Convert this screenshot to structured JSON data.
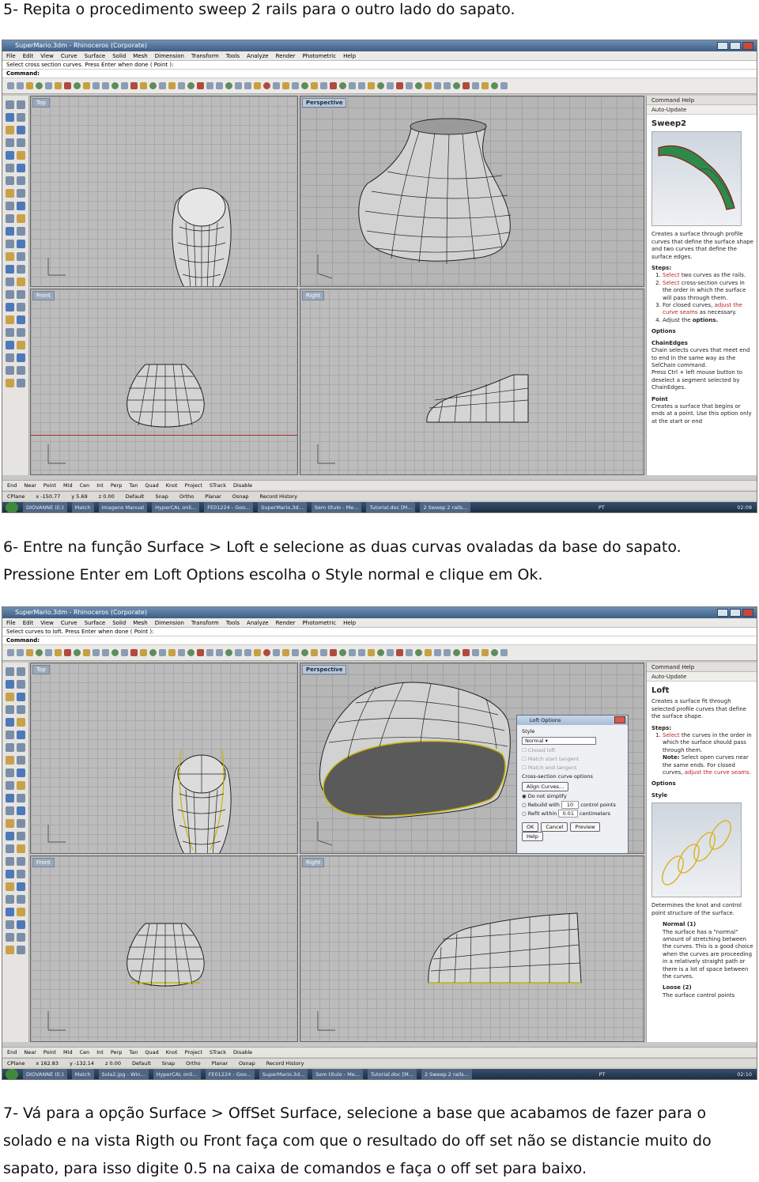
{
  "steps": {
    "step5": "5- Repita o procedimento sweep 2 rails para o outro lado do sapato.",
    "step6_line1": "6- Entre na função Surface > Loft e selecione as duas curvas ovaladas da base do sapato.",
    "step6_line2": "Pressione Enter em Loft Options escolha o Style normal e clique em Ok.",
    "step7_line1": "7- Vá para a opção Surface > OffSet Surface, selecione a base que acabamos de fazer para o",
    "step7_line2": "solado e na vista Rigth ou Front faça com que o resultado do off set não se distancie muito do",
    "step7_line3": "sapato, para isso digite 0.5 na caixa de comandos e faça o off set para baixo."
  },
  "app": {
    "window_title": "SuperMario.3dm - Rhinoceros (Corporate)",
    "menu": [
      "File",
      "Edit",
      "View",
      "Curve",
      "Surface",
      "Solid",
      "Mesh",
      "Dimension",
      "Transform",
      "Tools",
      "Analyze",
      "Render",
      "Photometric",
      "Help"
    ],
    "viewports": {
      "top": "Top",
      "perspective": "Perspective",
      "front": "Front",
      "right": "Right"
    },
    "panel_header": "Command Help",
    "auto_update": "Auto-Update",
    "osnaps": [
      "End",
      "Near",
      "Point",
      "Mid",
      "Cen",
      "Int",
      "Perp",
      "Tan",
      "Quad",
      "Knot",
      "Project",
      "STrack",
      "Disable"
    ],
    "status": {
      "cplane": "CPlane",
      "snap": "Snap",
      "ortho": "Ortho",
      "planar": "Planar",
      "osnap": "Osnap",
      "record": "Record History",
      "layer": "Default"
    }
  },
  "shot1": {
    "prompt": "Select cross section curves. Press Enter when done ( Point ):",
    "command_label": "Command:",
    "coords": {
      "x": "x -150.77",
      "y": "y 5.69",
      "z": "z 0.00"
    },
    "help": {
      "command": "Sweep2",
      "intro": "Creates a surface through profile curves that define the surface shape and two curves that define the surface edges.",
      "steps_title": "Steps:",
      "step1_a": "Select",
      "step1_b": "two curves as the rails.",
      "step2_a": "Select",
      "step2_b": "cross-section curves in the order in which the surface will pass through them.",
      "step3_a": "For closed curves,",
      "step3_b": "adjust the curve seams",
      "step3_c": "as necessary.",
      "step4_a": "Adjust the",
      "step4_b": "options.",
      "options_title": "Options",
      "chainedges_title": "ChainEdges",
      "chainedges_text": "Chain selects curves that meet end to end in the same way as the SelChain command.",
      "chainedges_text2": "Press Ctrl + left mouse button to deselect a segment selected by ChainEdges.",
      "point_title": "Point",
      "point_text": "Creates a surface that begins or ends at a point. Use this option only at the start or end"
    },
    "taskbar": [
      "DIOVANNE (E:)",
      "Match",
      "Imagens Manual",
      "HyperCAL onli...",
      "FE01224 - Goo...",
      "SuperMario.3d...",
      "Sem título - Me...",
      "Tutorial.doc [M...",
      "2 Sweep 2 rails..."
    ],
    "lang": "PT",
    "clock": "02:09"
  },
  "shot2": {
    "prompt": "Select curves to loft. Press Enter when done ( Point ):",
    "command_label": "Command:",
    "coords": {
      "x": "x 162.83",
      "y": "y -132.14",
      "z": "z 0.00"
    },
    "help": {
      "command": "Loft",
      "intro": "Creates a surface fit through selected profile curves that define the surface shape.",
      "steps_title": "Steps:",
      "step1_a": "Select",
      "step1_b": "the curves in the order in which the surface should pass through them.",
      "note_a": "Note:",
      "note_b": "Select open curves near the same ends. For closed curves,",
      "note_c": "adjust the curve seams.",
      "options_title": "Options",
      "style_title": "Style",
      "style_text": "Determines the knot and control point structure of the surface.",
      "normal_title": "Normal (1)",
      "normal_text": "The surface has a \"normal\" amount of stretching between the curves. This is a good choice when the curves are proceeding in a relatively straight path or there is a lot of space between the curves.",
      "loose_title": "Loose (2)",
      "loose_text": "The surface control points"
    },
    "dialog": {
      "title": "Loft Options",
      "style_label": "Style",
      "style_value": "Normal",
      "closed_loft": "Closed loft",
      "match_start": "Match start tangent",
      "match_end": "Match end tangent",
      "cross_section": "Cross-section curve options",
      "align_curves": "Align Curves...",
      "do_not_simplify": "Do not simplify",
      "rebuild_with": "Rebuild with",
      "rebuild_value": "10",
      "control_points": "control points",
      "refit_within": "Refit within",
      "refit_value": "0.01",
      "centimeters": "centimeters",
      "ok": "OK",
      "cancel": "Cancel",
      "preview": "Preview",
      "help": "Help"
    },
    "taskbar": [
      "DIOVANNE (E:)",
      "Match",
      "Sola2.jpg - Win...",
      "HyperCAL onli...",
      "FE01224 - Goo...",
      "SuperMario.3d...",
      "Sem título - Me...",
      "Tutorial.doc [M...",
      "2 Sweep 2 rails..."
    ],
    "lang": "PT",
    "clock": "02:10"
  }
}
